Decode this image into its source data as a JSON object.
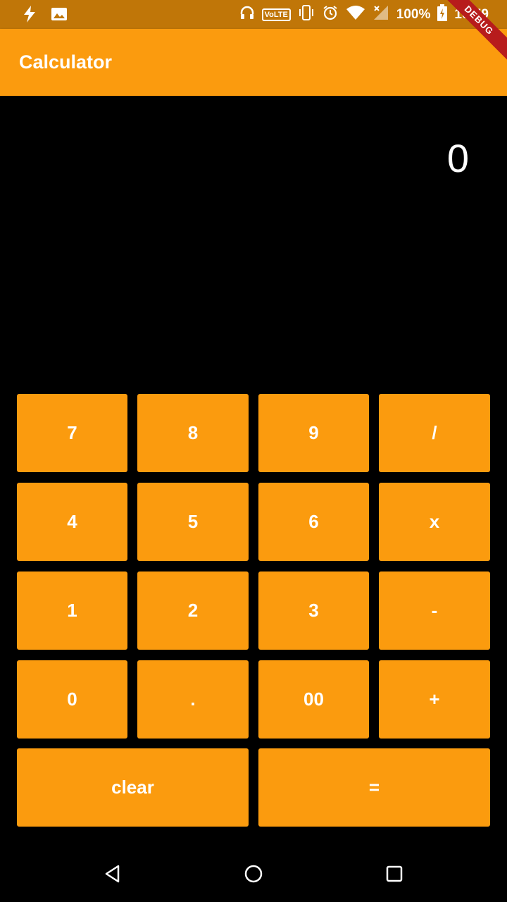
{
  "status_bar": {
    "volte": "VoLTE",
    "battery": "100%",
    "time": "10:59"
  },
  "debug_banner": "DEBUG",
  "app_bar": {
    "title": "Calculator"
  },
  "display": {
    "value": "0"
  },
  "keys": {
    "k7": "7",
    "k8": "8",
    "k9": "9",
    "divide": "/",
    "k4": "4",
    "k5": "5",
    "k6": "6",
    "multiply": "x",
    "k1": "1",
    "k2": "2",
    "k3": "3",
    "subtract": "-",
    "k0": "0",
    "decimal": ".",
    "k00": "00",
    "add": "+",
    "clear": "clear",
    "equals": "="
  },
  "colors": {
    "status_bar": "#C07608",
    "accent": "#FB9B0E",
    "background": "#000000",
    "debug": "#B71C1C"
  }
}
